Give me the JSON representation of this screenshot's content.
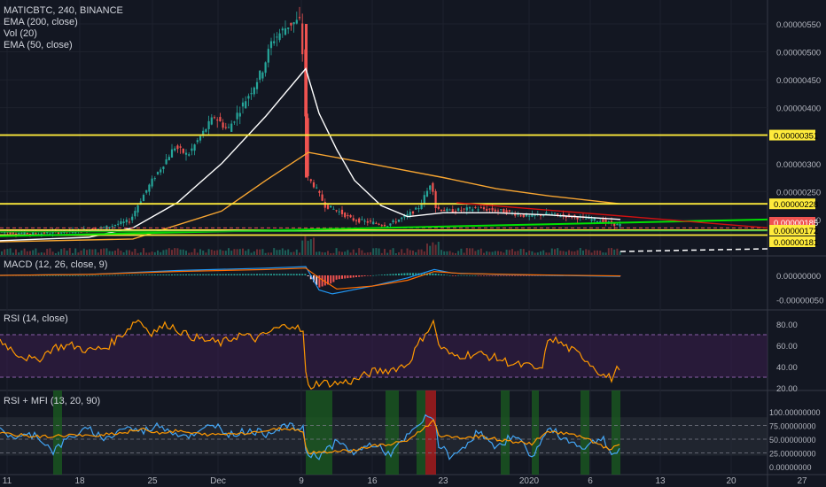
{
  "header": {
    "title": "MATICBTC, 240, BINANCE",
    "indicators": [
      "EMA (200, close)",
      "Vol (20)",
      "EMA (50, close)"
    ]
  },
  "panes": {
    "macd_label": "MACD (12, 26, close, 9)",
    "rsi_label": "RSI (14, close)",
    "rsimfi_label": "RSI + MFI (13, 20, 90)"
  },
  "colors": {
    "background": "#131722",
    "up_candle": "#26a69a",
    "down_candle": "#ef5350",
    "ema50": "#ffffff",
    "ema200": "#f7a531",
    "horizontal_level": "#ffeb3b",
    "trendline_support": "#00e000",
    "trendline_resistance": "#d01010",
    "rsi_line": "#ff9800",
    "rsi_band": "#3a1d4d",
    "mfi_line": "#42a5f5"
  },
  "chart_data": [
    {
      "type": "candlestick",
      "symbol": "MATICBTC",
      "interval": "240",
      "exchange": "BINANCE",
      "x_ticks": [
        "11",
        "18",
        "25",
        "Dec",
        "9",
        "16",
        "23",
        "2020",
        "6",
        "13",
        "20",
        "27"
      ],
      "y_ticks": [
        "0.00000550",
        "0.00000500",
        "0.00000450",
        "0.00000400",
        "0.00000300",
        "0.00000250",
        "0.00000200"
      ],
      "ylim": [
        1.55e-06,
        5.65e-06
      ],
      "price_path": [
        [
          0,
          1.78
        ],
        [
          40,
          1.75
        ],
        [
          80,
          1.78
        ],
        [
          120,
          1.85
        ],
        [
          150,
          1.98
        ],
        [
          160,
          2.3
        ],
        [
          175,
          2.7
        ],
        [
          190,
          3.05
        ],
        [
          200,
          3.3
        ],
        [
          215,
          3.15
        ],
        [
          230,
          3.5
        ],
        [
          245,
          3.85
        ],
        [
          260,
          3.6
        ],
        [
          275,
          4.0
        ],
        [
          290,
          4.4
        ],
        [
          300,
          4.7
        ],
        [
          310,
          5.2
        ],
        [
          320,
          5.35
        ],
        [
          330,
          5.5
        ],
        [
          342,
          5.55
        ],
        [
          346,
          4.6
        ],
        [
          350,
          2.75
        ],
        [
          358,
          2.6
        ],
        [
          370,
          2.25
        ],
        [
          385,
          2.15
        ],
        [
          400,
          2.0
        ],
        [
          420,
          1.95
        ],
        [
          440,
          1.9
        ],
        [
          460,
          2.05
        ],
        [
          475,
          2.2
        ],
        [
          485,
          2.5
        ],
        [
          490,
          2.7
        ],
        [
          495,
          2.2
        ],
        [
          510,
          2.15
        ],
        [
          540,
          2.2
        ],
        [
          570,
          2.15
        ],
        [
          600,
          2.05
        ],
        [
          620,
          2.1
        ],
        [
          650,
          2.05
        ],
        [
          680,
          1.98
        ],
        [
          700,
          1.9
        ]
      ],
      "ema50_path": [
        [
          0,
          1.62
        ],
        [
          100,
          1.68
        ],
        [
          150,
          1.85
        ],
        [
          200,
          2.3
        ],
        [
          250,
          3.0
        ],
        [
          300,
          3.85
        ],
        [
          345,
          4.7
        ],
        [
          360,
          3.9
        ],
        [
          380,
          3.25
        ],
        [
          400,
          2.7
        ],
        [
          430,
          2.25
        ],
        [
          460,
          2.05
        ],
        [
          500,
          2.12
        ],
        [
          560,
          2.12
        ],
        [
          620,
          2.08
        ],
        [
          700,
          2.0
        ]
      ],
      "ema200_path": [
        [
          0,
          1.6
        ],
        [
          150,
          1.65
        ],
        [
          250,
          2.15
        ],
        [
          300,
          2.7
        ],
        [
          348,
          3.2
        ],
        [
          400,
          3.05
        ],
        [
          450,
          2.9
        ],
        [
          500,
          2.75
        ],
        [
          560,
          2.55
        ],
        [
          620,
          2.42
        ],
        [
          700,
          2.28
        ]
      ],
      "levels": [
        {
          "label": "0.00000351",
          "value": 3.51e-06
        },
        {
          "label": "0.00000228",
          "value": 2.28e-06
        },
        {
          "label": "0.00000185",
          "value": 1.85e-06
        },
        {
          "label": "0.00000181",
          "value": 1.81e-06
        },
        {
          "label": "0.00000172",
          "value": 1.72e-06
        }
      ],
      "last_price": {
        "label": "0.00000185",
        "value": 1.85e-06
      },
      "volume_level_label": "0.00000181"
    },
    {
      "type": "line",
      "name": "MACD",
      "y_ticks": [
        "0.00000000",
        "-0.00000050"
      ],
      "ylim": [
        -6e-07,
        2e-07
      ],
      "macd": [
        [
          0,
          0
        ],
        [
          100,
          0.02
        ],
        [
          200,
          0.1
        ],
        [
          300,
          0.15
        ],
        [
          345,
          0.18
        ],
        [
          360,
          -0.3
        ],
        [
          375,
          -0.38
        ],
        [
          420,
          -0.22
        ],
        [
          460,
          -0.05
        ],
        [
          490,
          0.12
        ],
        [
          510,
          0.05
        ],
        [
          560,
          0.02
        ],
        [
          620,
          0
        ],
        [
          700,
          -0.02
        ]
      ],
      "signal": [
        [
          0,
          0
        ],
        [
          100,
          0.02
        ],
        [
          200,
          0.08
        ],
        [
          300,
          0.12
        ],
        [
          345,
          0.15
        ],
        [
          360,
          -0.05
        ],
        [
          380,
          -0.28
        ],
        [
          420,
          -0.22
        ],
        [
          460,
          -0.1
        ],
        [
          490,
          0.08
        ],
        [
          520,
          0.04
        ],
        [
          600,
          0.01
        ],
        [
          700,
          -0.01
        ]
      ]
    },
    {
      "type": "line",
      "name": "RSI",
      "y_ticks": [
        "80.00",
        "60.00",
        "40.00",
        "20.00"
      ],
      "ylim": [
        15,
        90
      ],
      "bands": [
        30,
        70
      ],
      "values": [
        [
          0,
          65
        ],
        [
          20,
          52
        ],
        [
          40,
          45
        ],
        [
          60,
          58
        ],
        [
          80,
          60
        ],
        [
          100,
          55
        ],
        [
          120,
          58
        ],
        [
          140,
          72
        ],
        [
          155,
          85
        ],
        [
          170,
          72
        ],
        [
          190,
          80
        ],
        [
          210,
          70
        ],
        [
          230,
          65
        ],
        [
          250,
          62
        ],
        [
          270,
          70
        ],
        [
          290,
          66
        ],
        [
          310,
          75
        ],
        [
          330,
          80
        ],
        [
          342,
          72
        ],
        [
          346,
          20
        ],
        [
          360,
          25
        ],
        [
          380,
          24
        ],
        [
          400,
          27
        ],
        [
          420,
          35
        ],
        [
          440,
          37
        ],
        [
          460,
          42
        ],
        [
          470,
          58
        ],
        [
          480,
          72
        ],
        [
          490,
          82
        ],
        [
          495,
          60
        ],
        [
          510,
          50
        ],
        [
          540,
          52
        ],
        [
          560,
          48
        ],
        [
          580,
          42
        ],
        [
          600,
          40
        ],
        [
          610,
          35
        ],
        [
          620,
          68
        ],
        [
          640,
          58
        ],
        [
          660,
          48
        ],
        [
          680,
          32
        ],
        [
          690,
          29
        ],
        [
          700,
          42
        ]
      ]
    },
    {
      "type": "line",
      "name": "RSI + MFI",
      "y_ticks": [
        "100.00000000",
        "75.00000000",
        "50.00000000",
        "25.00000000",
        "0.00000000"
      ],
      "ylim": [
        0,
        100
      ],
      "bands": [
        20,
        90
      ],
      "rsi": [
        [
          0,
          60
        ],
        [
          20,
          58
        ],
        [
          40,
          55
        ],
        [
          60,
          55
        ],
        [
          80,
          58
        ],
        [
          100,
          55
        ],
        [
          120,
          60
        ],
        [
          140,
          62
        ],
        [
          160,
          68
        ],
        [
          180,
          62
        ],
        [
          200,
          65
        ],
        [
          220,
          60
        ],
        [
          240,
          58
        ],
        [
          260,
          60
        ],
        [
          280,
          62
        ],
        [
          300,
          65
        ],
        [
          320,
          70
        ],
        [
          342,
          66
        ],
        [
          346,
          25
        ],
        [
          360,
          27
        ],
        [
          380,
          28
        ],
        [
          400,
          30
        ],
        [
          420,
          38
        ],
        [
          440,
          40
        ],
        [
          460,
          48
        ],
        [
          480,
          72
        ],
        [
          490,
          85
        ],
        [
          495,
          58
        ],
        [
          510,
          52
        ],
        [
          540,
          55
        ],
        [
          560,
          50
        ],
        [
          580,
          45
        ],
        [
          600,
          42
        ],
        [
          620,
          65
        ],
        [
          640,
          60
        ],
        [
          660,
          52
        ],
        [
          680,
          36
        ],
        [
          690,
          32
        ],
        [
          700,
          40
        ]
      ],
      "mfi": [
        [
          0,
          65
        ],
        [
          20,
          52
        ],
        [
          40,
          60
        ],
        [
          60,
          28
        ],
        [
          80,
          55
        ],
        [
          100,
          68
        ],
        [
          120,
          50
        ],
        [
          140,
          72
        ],
        [
          160,
          64
        ],
        [
          180,
          76
        ],
        [
          200,
          60
        ],
        [
          220,
          55
        ],
        [
          240,
          80
        ],
        [
          260,
          58
        ],
        [
          280,
          66
        ],
        [
          300,
          60
        ],
        [
          320,
          75
        ],
        [
          342,
          68
        ],
        [
          346,
          22
        ],
        [
          360,
          20
        ],
        [
          380,
          45
        ],
        [
          400,
          25
        ],
        [
          420,
          42
        ],
        [
          440,
          22
        ],
        [
          460,
          55
        ],
        [
          480,
          88
        ],
        [
          490,
          92
        ],
        [
          495,
          40
        ],
        [
          510,
          15
        ],
        [
          540,
          65
        ],
        [
          560,
          30
        ],
        [
          580,
          62
        ],
        [
          600,
          18
        ],
        [
          620,
          70
        ],
        [
          640,
          48
        ],
        [
          660,
          35
        ],
        [
          680,
          55
        ],
        [
          690,
          22
        ],
        [
          700,
          30
        ]
      ],
      "highlight_green": [
        [
          60,
          70
        ],
        [
          345,
          375
        ],
        [
          435,
          450
        ],
        [
          470,
          480
        ],
        [
          565,
          575
        ],
        [
          600,
          608
        ],
        [
          655,
          665
        ],
        [
          690,
          700
        ]
      ],
      "highlight_red": [
        [
          480,
          492
        ]
      ]
    }
  ],
  "labels_ytick_fontsize_note": ""
}
